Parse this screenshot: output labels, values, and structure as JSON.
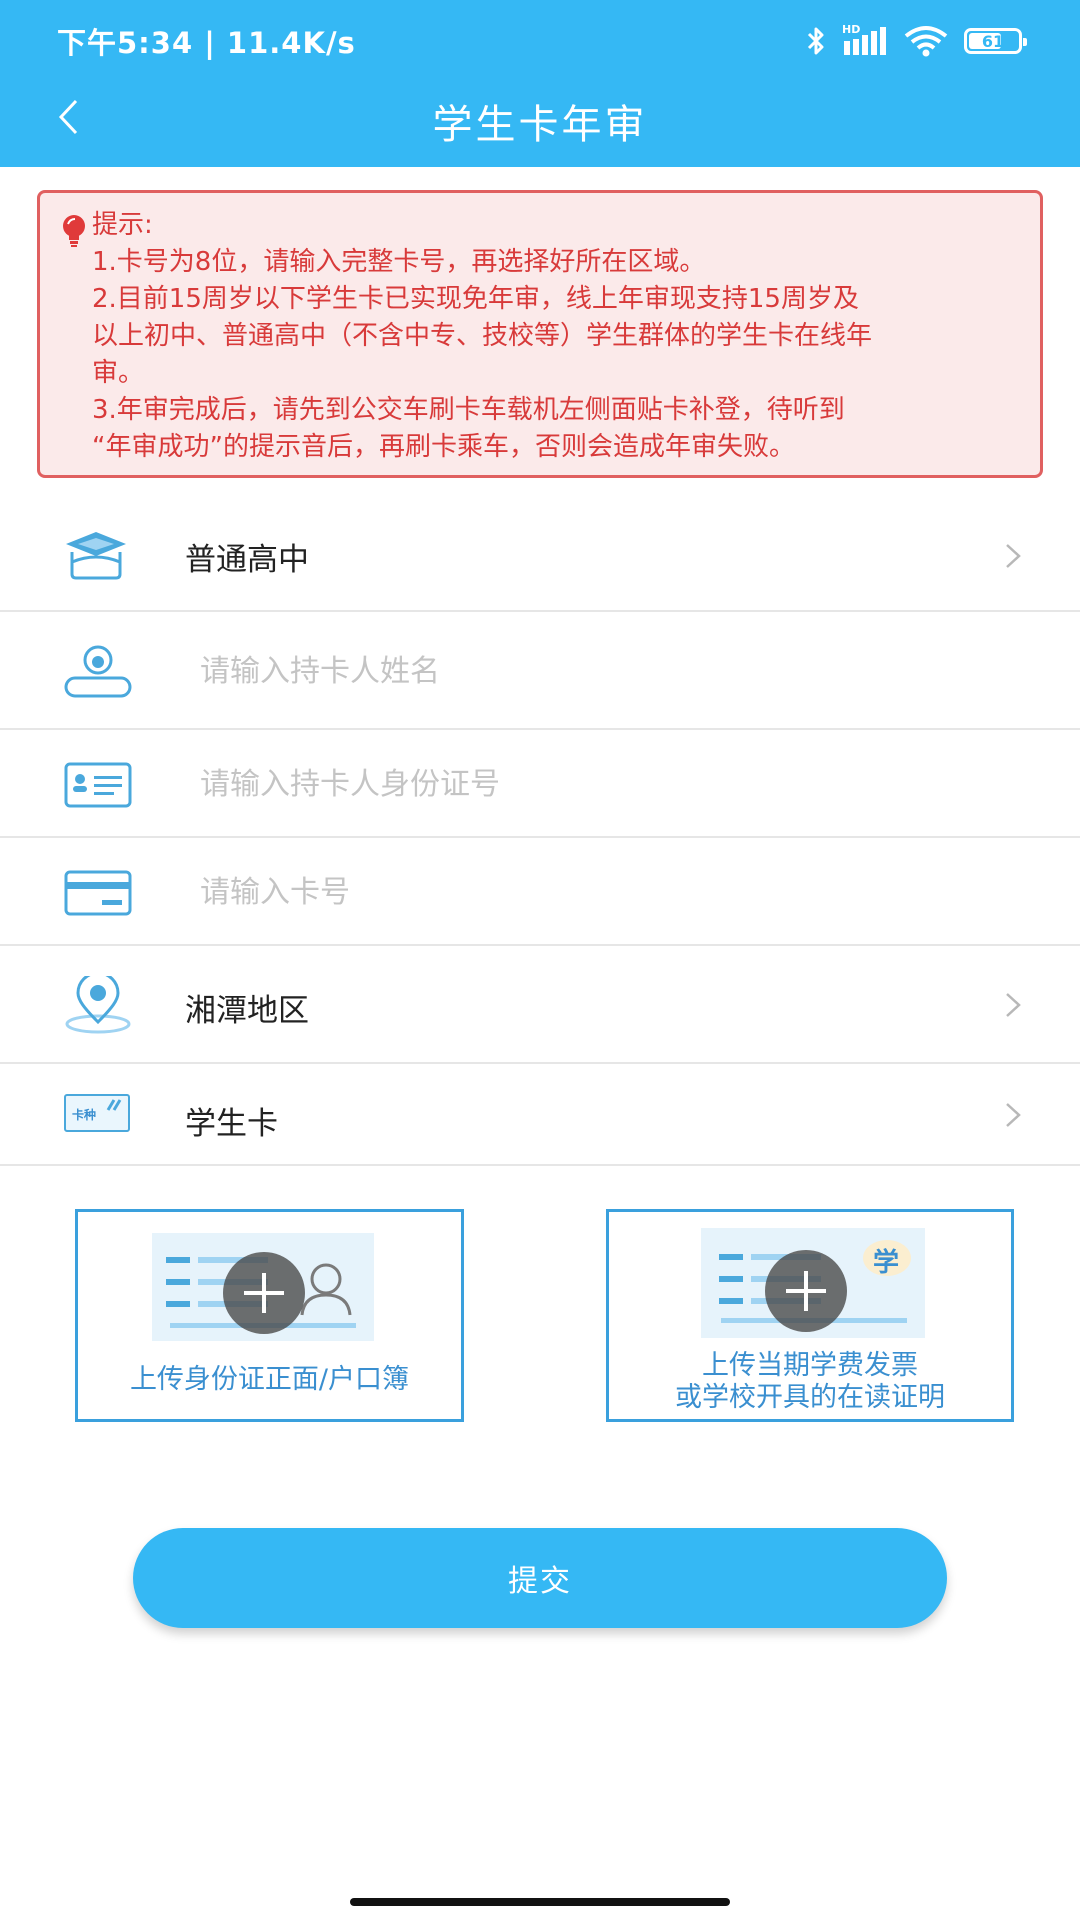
{
  "status_bar": {
    "time": "下午5:34 | 11.4K/s",
    "network_badge": "HD",
    "battery_level": "61",
    "icons": [
      "bluetooth-icon",
      "signal-icon",
      "wifi-icon",
      "battery-icon"
    ]
  },
  "nav": {
    "title": "学生卡年审",
    "back_icon": "chevron-left-icon"
  },
  "notice": {
    "title": "提示:",
    "lines": [
      "1.卡号为8位，请输入完整卡号，再选择好所在区域。",
      "2.目前15周岁以下学生卡已实现免年审，线上年审现支持15周岁及",
      "以上初中、普通高中（不含中专、技校等）学生群体的学生卡在线年",
      "审。",
      "3.年审完成后，请先到公交车刷卡车载机左侧面贴卡补登，待听到",
      "“年审成功”的提示音后，再刷卡乘车，否则会造成年审失败。"
    ],
    "icon": "lightbulb-icon"
  },
  "form": {
    "school_type": "普通高中",
    "name_placeholder": "请输入持卡人姓名",
    "id_placeholder": "请输入持卡人身份证号",
    "card_placeholder": "请输入卡号",
    "region": "湘潭地区",
    "card_type": "学生卡",
    "card_type_badge": "卡种"
  },
  "uploads": {
    "id_card": {
      "caption": "上传身份证正面/户口簿"
    },
    "school_proof": {
      "caption_line1": "上传当期学费发票",
      "caption_line2": "或学校开具的在读证明",
      "badge": "学"
    }
  },
  "submit_label": "提交",
  "colors": {
    "primary": "#35b8f4",
    "notice_text": "#d83a3a",
    "notice_border": "#e06060",
    "icon_blue": "#4aa8dc"
  }
}
